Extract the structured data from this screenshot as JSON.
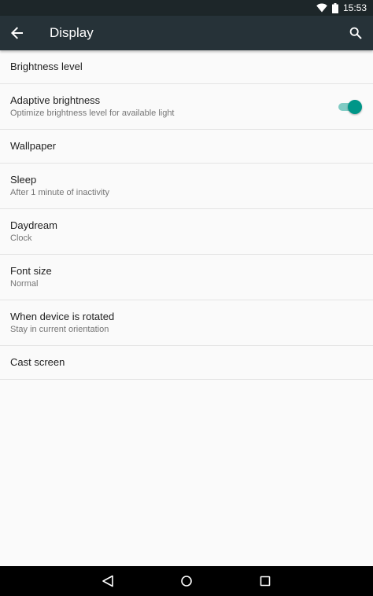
{
  "status_bar": {
    "time": "15:53",
    "icons": [
      "wifi-icon",
      "battery-icon"
    ]
  },
  "app_bar": {
    "title": "Display",
    "back_icon": "arrow-back-icon",
    "search_icon": "search-icon"
  },
  "settings": {
    "brightness": {
      "title": "Brightness level"
    },
    "adaptive": {
      "title": "Adaptive brightness",
      "summary": "Optimize brightness level for available light",
      "enabled": true
    },
    "wallpaper": {
      "title": "Wallpaper"
    },
    "sleep": {
      "title": "Sleep",
      "summary": "After 1 minute of inactivity"
    },
    "daydream": {
      "title": "Daydream",
      "summary": "Clock"
    },
    "font_size": {
      "title": "Font size",
      "summary": "Normal"
    },
    "rotation": {
      "title": "When device is rotated",
      "summary": "Stay in current orientation"
    },
    "cast": {
      "title": "Cast screen"
    }
  },
  "nav_bar": {
    "icons": [
      "back-triangle-icon",
      "home-circle-icon",
      "recents-square-icon"
    ]
  },
  "colors": {
    "app_bar": "#263238",
    "status_bar": "#1d2629",
    "accent": "#009688",
    "accent_track": "#80cbc4"
  }
}
